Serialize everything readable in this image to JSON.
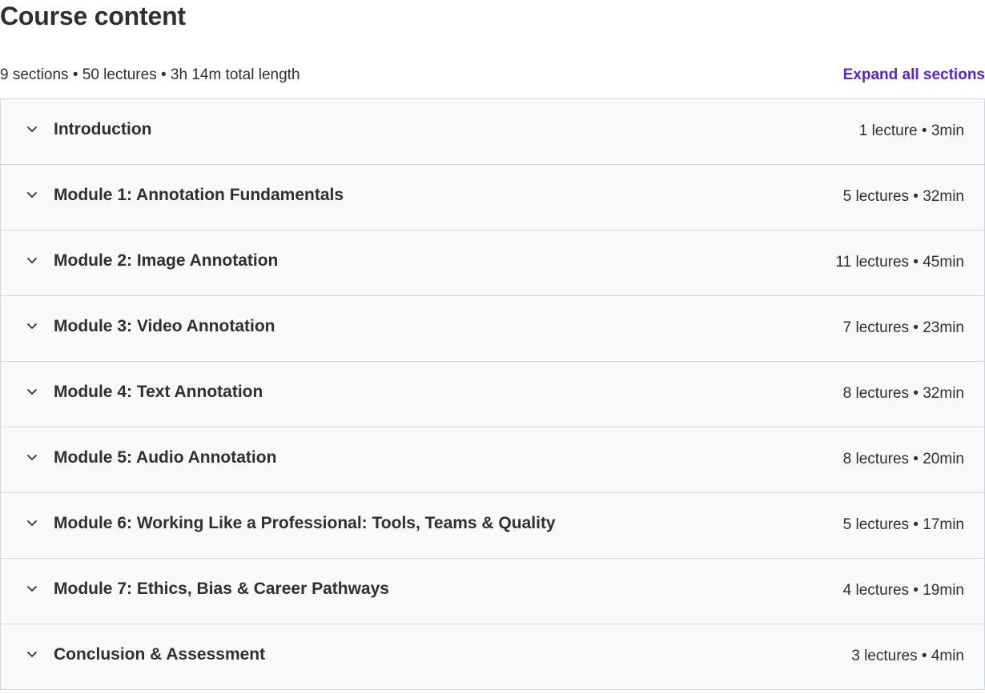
{
  "page": {
    "title": "Course content",
    "summary": "9 sections • 50 lectures • 3h 14m total length",
    "expand_label": "Expand all sections"
  },
  "colors": {
    "accent": "#5624d0",
    "text": "#2d2f31",
    "panel_bg": "#f7f9fa",
    "border": "#d1d7dc"
  },
  "sections": [
    {
      "title": "Introduction",
      "meta": "1 lecture • 3min",
      "icon": "chevron-down-icon"
    },
    {
      "title": "Module 1: Annotation Fundamentals",
      "meta": "5 lectures • 32min",
      "icon": "chevron-down-icon"
    },
    {
      "title": "Module 2: Image Annotation",
      "meta": "11 lectures • 45min",
      "icon": "chevron-down-icon"
    },
    {
      "title": "Module 3: Video Annotation",
      "meta": "7 lectures • 23min",
      "icon": "chevron-down-icon"
    },
    {
      "title": "Module 4: Text Annotation",
      "meta": "8 lectures • 32min",
      "icon": "chevron-down-icon"
    },
    {
      "title": "Module 5: Audio Annotation",
      "meta": "8 lectures • 20min",
      "icon": "chevron-down-icon"
    },
    {
      "title": "Module 6: Working Like a Professional: Tools, Teams & Quality",
      "meta": "5 lectures • 17min",
      "icon": "chevron-down-icon"
    },
    {
      "title": "Module 7: Ethics, Bias & Career Pathways",
      "meta": "4 lectures • 19min",
      "icon": "chevron-down-icon"
    },
    {
      "title": "Conclusion & Assessment",
      "meta": "3 lectures • 4min",
      "icon": "chevron-down-icon"
    }
  ]
}
